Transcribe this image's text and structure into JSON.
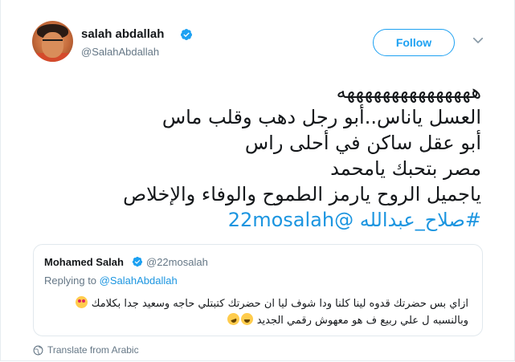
{
  "author": {
    "name": "salah abdallah",
    "handle": "@SalahAbdallah"
  },
  "follow_label": "Follow",
  "tweet_lines": [
    "هههههههههههههههه",
    "العسل ياناس..أبو رجل دهب وقلب ماس",
    "أبو عقل ساكن في أحلى راس",
    "مصر بتحبك يامحمد",
    "ياجميل الروح يارمز الطموح والوفاء والإخلاص",
    "#صلاح_عبدالله @22mosalah"
  ],
  "quoted": {
    "name": "Mohamed Salah",
    "handle": "@22mosalah",
    "replying_prefix": "Replying to",
    "replying_to": "@SalahAbdallah",
    "lines": [
      "ازاي بس حضرتك قدوه لينا كلنا ودا شوف ليا ان حضرتك كتبتلي حاجه وسعيد جدا بكلامك",
      "وبالنسبه ل علي ربيع ف هو معهوش رقمي الجديد"
    ],
    "emojis": [
      "heart-eyes",
      "grin",
      "laugh"
    ]
  },
  "translate_label": "Translate from Arabic",
  "colors": {
    "link": "#1b95e0",
    "follow": "#1da1f2",
    "secondary": "#657786"
  }
}
